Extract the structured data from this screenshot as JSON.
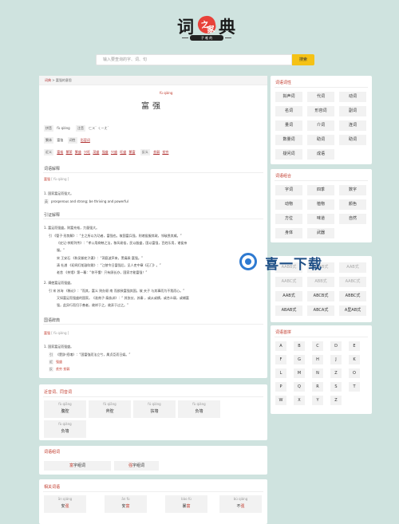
{
  "logo": {
    "chars": [
      "词",
      "之",
      "家",
      "典"
    ],
    "sub": "子 唯 的"
  },
  "search": {
    "placeholder": "输入要查询的字、词、句",
    "button": "搜索"
  },
  "breadcrumb": {
    "home": "词典",
    "sep": ">",
    "current": "富强的意思"
  },
  "word": {
    "pinyin": "fù qiáng",
    "title": "富强"
  },
  "info": {
    "line1": {
      "pinyin_tag": "拼音",
      "pinyin": "fù qiáng",
      "zhuyin_tag": "注音",
      "zhuyin": "ㄈㄨˋ ㄑㄧㄤˊ"
    },
    "line2": {
      "fanti_tag": "繁体",
      "fanti": "富強",
      "cixing_tag": "词性",
      "cixing": "形容词"
    },
    "line3": {
      "jin_tag": "近义",
      "jin": [
        "富裕",
        "繁荣",
        "繁盛",
        "兴旺",
        "茂盛",
        "强盛",
        "兴盛",
        "旺盛",
        "繁富"
      ],
      "fan_tag": "反义",
      "fan": [
        "贫弱",
        "贫穷"
      ]
    }
  },
  "sections": {
    "jieshi": "词语解释",
    "jieshi_head": "富强",
    "jieshi_head_py": "[ fù qiáng ]",
    "jieshi_1": "1. 国家富足而强大。",
    "jieshi_1_en": "prosperous and strong; be thriving and powerful",
    "jieshi_1_mk": "英",
    "yinzheng": "引证解释",
    "yz_1": "1. 富足而强盛。财富充裕，力量强大。",
    "yz_1a": "引 《管子·形势解》：“主之所以为功者，富强也。故国富兵强，则诸侯服其政，邻敌畏其威。”",
    "yz_1b": "《史记·李斯列传》：“孝公用商鞅之法，移风易俗，民以殷盛，国以富强，百姓乐用，诸侯亲",
    "yz_1c": "服。”",
    "yz_1d": "宋 王安石 《和吴御史汴渠》：“洞庭波声来，黑痛乘 富强。”",
    "yz_1e": "清 杜濬 《初闻灯船鼓吹歌》：“江陵令日富强后，见人吏中章《石门》。”",
    "yz_1f": "老舍 《茶馆》第一幕：“你不懂！只有顾长办，国家才能富强！”",
    "yz_2": "2. 谓使富足而强盛。",
    "yz_2a": "引 宋 苏洵 《衡论》：“而其，富义 则办顾 南 而欲致富强其国。故 夫子 与其事而为不我而心。”",
    "yz_2b": "又如富足而强盛的国家。《淮南子·泰族训》：“ 其张仪、苏秦 ，或从或横，或合众弱，或辅富",
    "yz_2c": "强，此异行而归于善者，故祥于之，故弄于过之。”",
    "cidian": "国语辞典",
    "cidian_head": "富强",
    "cidian_head_py": "[ fù qiáng ]",
    "cd_1": "1. 国家富足而强盛。",
    "cd_1a": "《楚辞·招魂》：“国富強而法立兮，属贞臣而日娱。”",
    "cd_1b": "强盛",
    "cd_1c": "贫穷 贫弱",
    "cd_mk1": "引",
    "cd_mk2": "近",
    "cd_mk3": "反"
  },
  "near": {
    "title": "近音词、同音词",
    "items": [
      {
        "py": "fù qiāng",
        "w": "腹腔"
      },
      {
        "py": "fǔ qiāng",
        "w": "斧腔"
      },
      {
        "py": "fú qiáng",
        "w": "扶墙"
      },
      {
        "py": "fù qiáng",
        "w": "负墙"
      },
      {
        "py": "fù qiáng",
        "w": "负墙"
      }
    ]
  },
  "zuci": {
    "title": "词语组词",
    "b1": "富字组词",
    "b1_hl": "富",
    "b2": "强字组词",
    "b2_hl": "强"
  },
  "related": {
    "title": "相关词语",
    "items": [
      {
        "py": "ān qiáng",
        "w": "安强",
        "hl": "强"
      },
      {
        "py": "ān fù",
        "w": "安富",
        "hl": "富"
      },
      {
        "py": "bào fù",
        "w": "暴富",
        "hl": "富"
      },
      {
        "py": "bù qiáng",
        "w": "不强",
        "hl": "强"
      }
    ]
  },
  "side": {
    "cixing": {
      "title": "词语词性",
      "items": [
        "拟声词",
        "代词",
        "动词",
        "名词",
        "形容词",
        "副词",
        "量词",
        "介词",
        "连词",
        "数量词",
        "助词",
        "助词",
        "疑问词",
        "成语"
      ]
    },
    "zuhe": {
      "title": "词语组合",
      "items": [
        "字词",
        "四季",
        "数字",
        "动物",
        "植物",
        "颜色",
        "方位",
        "味道",
        "自然",
        "身体",
        "武器"
      ]
    },
    "geshi": {
      "items": [
        "AABB式",
        "ABAB式",
        "AAB式",
        "AABC式",
        "ABB式",
        "AABC式",
        "AAB式",
        "ABCB式",
        "ABBC式",
        "ABAB式",
        "ABCA式",
        "A里AB式"
      ]
    },
    "pinyin": {
      "title": "词语首拼",
      "letters": [
        "A",
        "B",
        "C",
        "D",
        "E",
        "F",
        "G",
        "H",
        "J",
        "K",
        "L",
        "M",
        "N",
        "Z",
        "O",
        "P",
        "Q",
        "R",
        "S",
        "T",
        "W",
        "X",
        "Y",
        "Z"
      ]
    }
  },
  "watermark": {
    "text": "喜一下载"
  }
}
